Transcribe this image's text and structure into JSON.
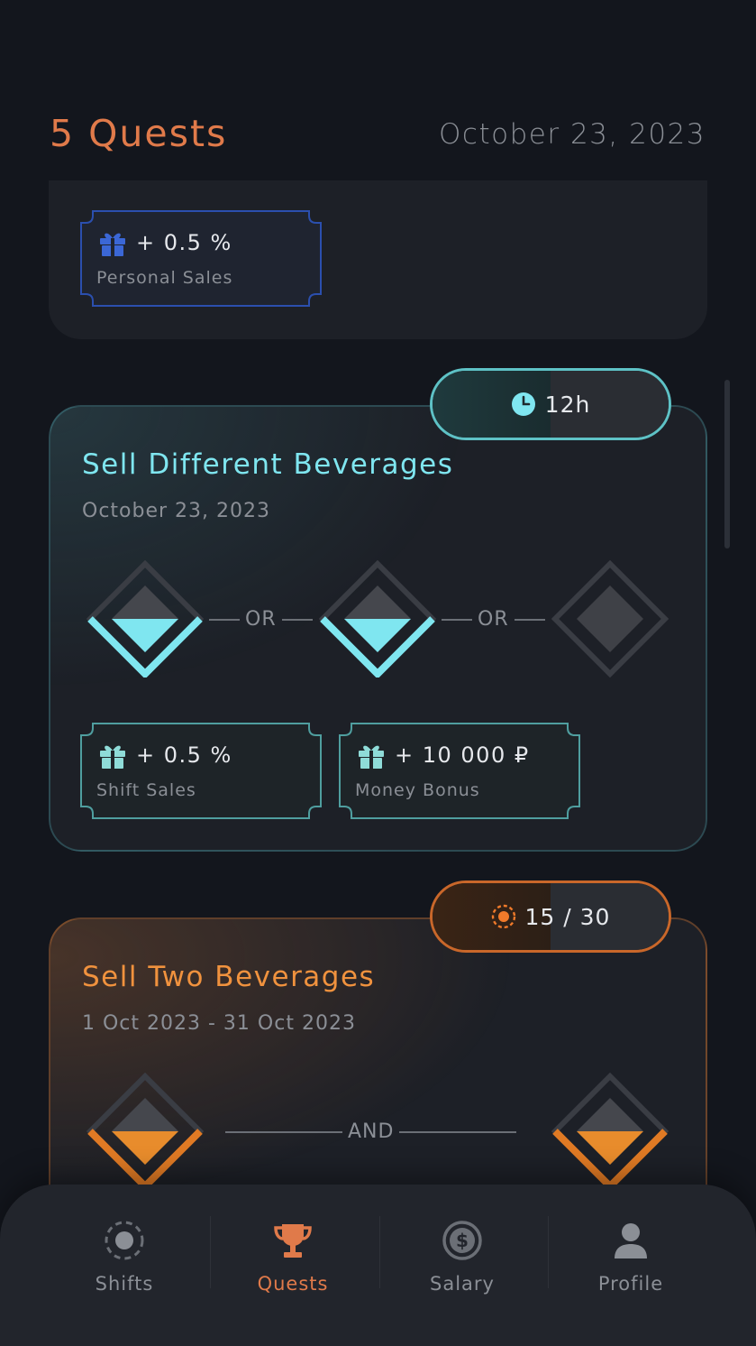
{
  "header": {
    "title": "5 Quests",
    "date": "October 23, 2023"
  },
  "colors": {
    "accent_orange": "#e07a4a",
    "accent_cyan": "#7fe6f0",
    "background": "#13161d",
    "card": "#1d2027"
  },
  "quest1": {
    "reward": {
      "icon": "gift-icon",
      "amount": "+ 0.5 %",
      "label": "Personal Sales"
    }
  },
  "quest2": {
    "timer": {
      "icon": "clock-icon",
      "value": "12h",
      "progress": 0.5
    },
    "title": "Sell Different Beverages",
    "date": "October 23, 2023",
    "separators": [
      "OR",
      "OR"
    ],
    "levels": [
      {
        "state": "filled"
      },
      {
        "state": "filled"
      },
      {
        "state": "empty"
      }
    ],
    "rewards": [
      {
        "icon": "gift-icon",
        "amount": "+ 0.5 %",
        "label": "Shift Sales"
      },
      {
        "icon": "gift-icon",
        "amount": "+ 10 000 ₽",
        "label": "Money Bonus"
      }
    ]
  },
  "quest3": {
    "progress": {
      "icon": "target-icon",
      "value": "15 / 30",
      "fraction": 0.5
    },
    "title": "Sell Two Beverages",
    "date": "1 Oct 2023  -  31 Oct 2023",
    "separator": "AND"
  },
  "tabs": [
    {
      "label": "Shifts",
      "icon": "shifts-icon",
      "active": false
    },
    {
      "label": "Quests",
      "icon": "trophy-icon",
      "active": true
    },
    {
      "label": "Salary",
      "icon": "dollar-icon",
      "active": false
    },
    {
      "label": "Profile",
      "icon": "profile-icon",
      "active": false
    }
  ]
}
